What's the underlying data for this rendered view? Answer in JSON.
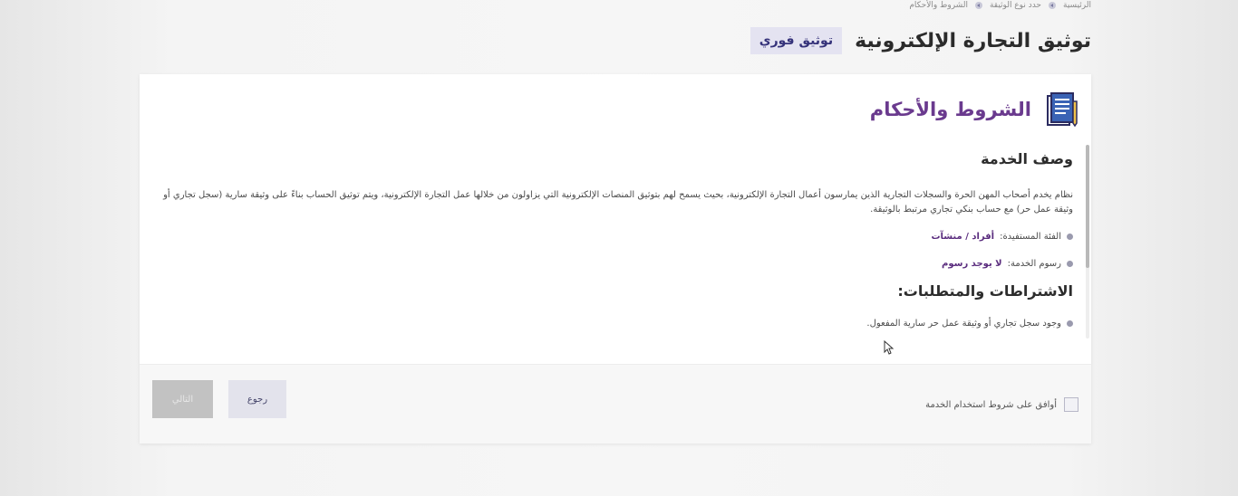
{
  "breadcrumb": {
    "items": [
      "الرئيسية",
      "حدد نوع الوثيقة",
      "الشروط والأحكام"
    ]
  },
  "header": {
    "title": "توثيق التجارة الإلكترونية",
    "badge": "توثيق فوري"
  },
  "card": {
    "title": "الشروط والأحكام",
    "service_description": {
      "heading": "وصف الخدمة",
      "text": "نظام يخدم أصحاب المهن الحرة والسجلات التجارية الذين يمارسون أعمال التجارة الإلكترونية، بحيث يسمح لهم بتوثيق المنصات الإلكترونية التي يزاولون من خلالها عمل التجارة الإلكترونية، ويتم توثيق الحساب بناءً على وثيقة سارية (سجل تجاري أو وثيقة عمل حر) مع حساب بنكي تجاري مرتبط بالوثيقة.",
      "items": [
        {
          "label": "الفئة المستفيدة:",
          "value": "أفراد / منشآت"
        },
        {
          "label": "رسوم الخدمة:",
          "value": "لا يوجد رسوم"
        }
      ]
    },
    "requirements": {
      "heading": "الاشتراطات والمتطلبات:",
      "items": [
        {
          "label": "وجود سجل تجاري أو وثيقة عمل حر سارية المفعول."
        }
      ]
    },
    "footer": {
      "agree_label": "أوافق على شروط استخدام الخدمة",
      "back_label": "رجوع",
      "next_label": "التالي"
    }
  },
  "colors": {
    "title_purple": "#6a3a8e",
    "badge_bg": "#e4e3f1",
    "badge_text": "#35327a"
  }
}
